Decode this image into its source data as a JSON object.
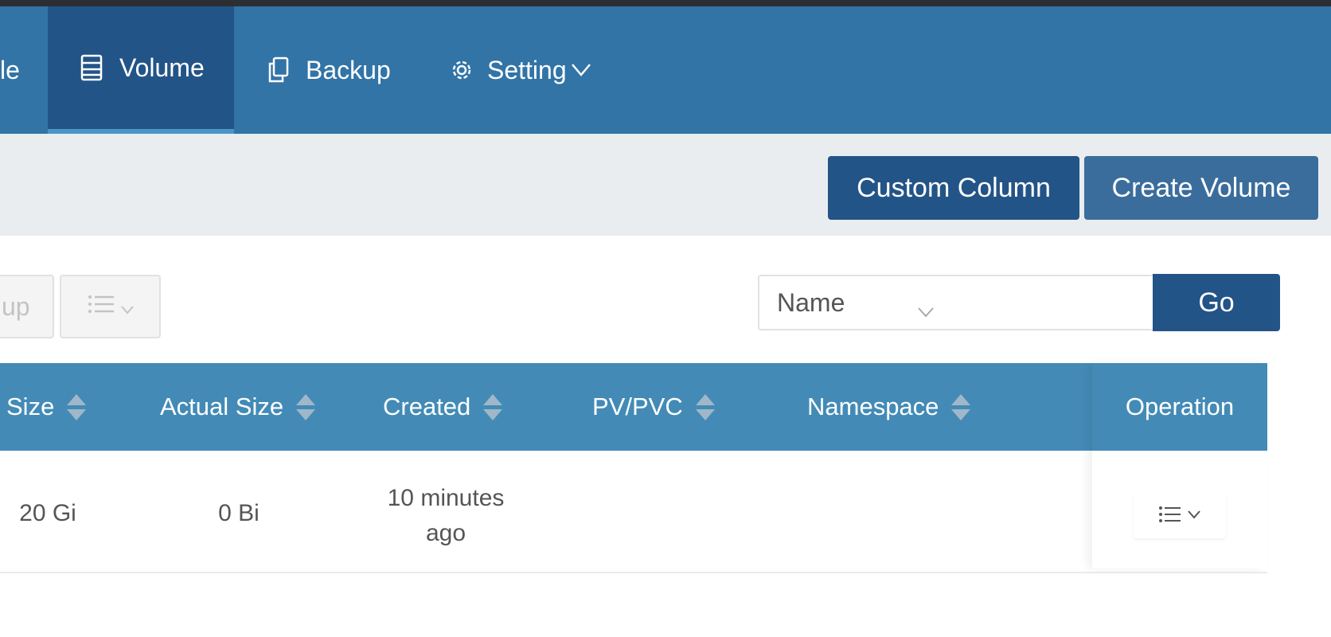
{
  "nav": {
    "partial_label": "le",
    "items": [
      {
        "label": "Volume",
        "icon": "volume-icon"
      },
      {
        "label": "Backup",
        "icon": "backup-icon"
      },
      {
        "label": "Setting",
        "icon": "gear-icon"
      }
    ]
  },
  "toolbar": {
    "custom_column_label": "Custom Column",
    "create_volume_label": "Create Volume"
  },
  "actions": {
    "partial_backup_label": "up"
  },
  "search": {
    "field_selected": "Name",
    "value": "",
    "go_label": "Go"
  },
  "table": {
    "headers": [
      "Size",
      "Actual Size",
      "Created",
      "PV/PVC",
      "Namespace"
    ],
    "operation_header": "Operation",
    "rows": [
      {
        "size": "20 Gi",
        "actual_size": "0 Bi",
        "created_line1": "10 minutes",
        "created_line2": "ago",
        "pv_pvc": "",
        "namespace": ""
      }
    ]
  },
  "colors": {
    "navbar": "#3274a6",
    "nav_active": "#235487",
    "primary_button": "#235487",
    "table_header": "#438bb6"
  }
}
